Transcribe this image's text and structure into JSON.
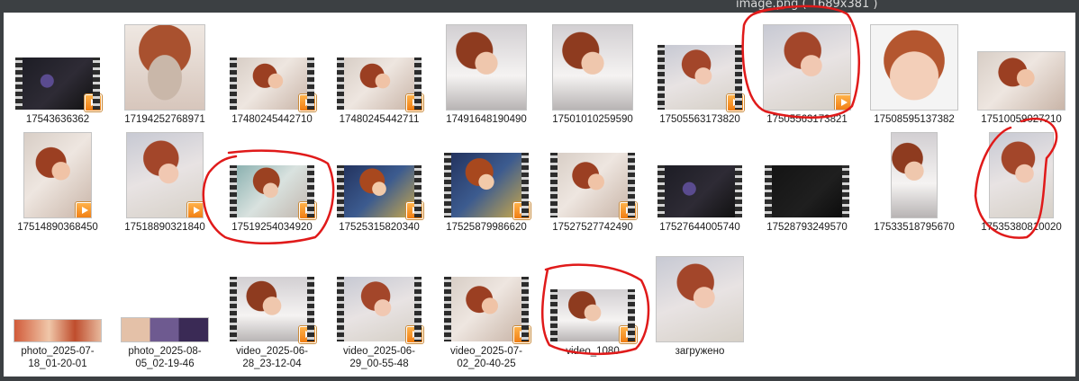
{
  "window": {
    "title": "image.png ( 1689x381 )"
  },
  "rows": [
    [
      {
        "name": "17543636362",
        "kind": "video",
        "style": "dark"
      },
      {
        "name": "17194252768971",
        "kind": "image",
        "style": "glass"
      },
      {
        "name": "17480245442710",
        "kind": "video",
        "style": "t1"
      },
      {
        "name": "17480245442711",
        "kind": "video",
        "style": "t1"
      },
      {
        "name": "17491648190490",
        "kind": "image",
        "style": "t2"
      },
      {
        "name": "17501010259590",
        "kind": "image",
        "style": "t2"
      },
      {
        "name": "17505563173820",
        "kind": "video",
        "style": "t3"
      },
      {
        "name": "17505563173821",
        "kind": "image",
        "style": "t3"
      },
      {
        "name": "17508595137382",
        "kind": "image",
        "style": "face"
      },
      {
        "name": "17510059027210",
        "kind": "image",
        "style": "t1"
      }
    ],
    [
      {
        "name": "17514890368450",
        "kind": "image",
        "style": "t1"
      },
      {
        "name": "17518890321840",
        "kind": "image",
        "style": "t3"
      },
      {
        "name": "17519254034920",
        "kind": "video",
        "style": "green"
      },
      {
        "name": "17525315820340",
        "kind": "video",
        "style": "blue"
      },
      {
        "name": "17525879986620",
        "kind": "video",
        "style": "blue"
      },
      {
        "name": "17527527742490",
        "kind": "video",
        "style": "t1"
      },
      {
        "name": "17527644005740",
        "kind": "video",
        "style": "dark"
      },
      {
        "name": "17528793249570",
        "kind": "video",
        "style": "black"
      },
      {
        "name": "17533518795670",
        "kind": "image",
        "style": "t2"
      },
      {
        "name": "17535380810020",
        "kind": "image",
        "style": "t3"
      }
    ],
    [
      {
        "name": "photo_2025-07-18_01-20-01",
        "kind": "image",
        "style": "strip"
      },
      {
        "name": "photo_2025-08-05_02-19-46",
        "kind": "image",
        "style": "collage"
      },
      {
        "name": "video_2025-06-28_23-12-04",
        "kind": "video",
        "style": "t2"
      },
      {
        "name": "video_2025-06-29_00-55-48",
        "kind": "video",
        "style": "t3"
      },
      {
        "name": "video_2025-07-02_20-40-25",
        "kind": "video",
        "style": "t1"
      },
      {
        "name": "video_1080",
        "kind": "video",
        "style": "t2"
      },
      {
        "name": "загружено",
        "kind": "image",
        "style": "t3"
      }
    ]
  ],
  "labels": {
    "r0": [
      "17543636362",
      "17194252768971",
      "17480245442710",
      "17480245442711",
      "17491648190490",
      "17501010259590",
      "17505563173820",
      "17505563173821",
      "17508595137382",
      "17510059027210"
    ],
    "r1": [
      "17514890368450",
      "17518890321840",
      "17519254034920",
      "17525315820340",
      "17525879986620",
      "17527527742490",
      "17527644005740",
      "17528793249570",
      "17533518795670",
      "17535380810020"
    ],
    "r2": [
      "photo_2025-07-18_01-20-01",
      "photo_2025-08-05_02-19-46",
      "video_2025-06-28_23-12-04",
      "video_2025-06-29_00-55-48",
      "video_2025-07-02_20-40-25",
      "video_1080",
      "загружено"
    ]
  },
  "annotation_color": "#e01a1a"
}
